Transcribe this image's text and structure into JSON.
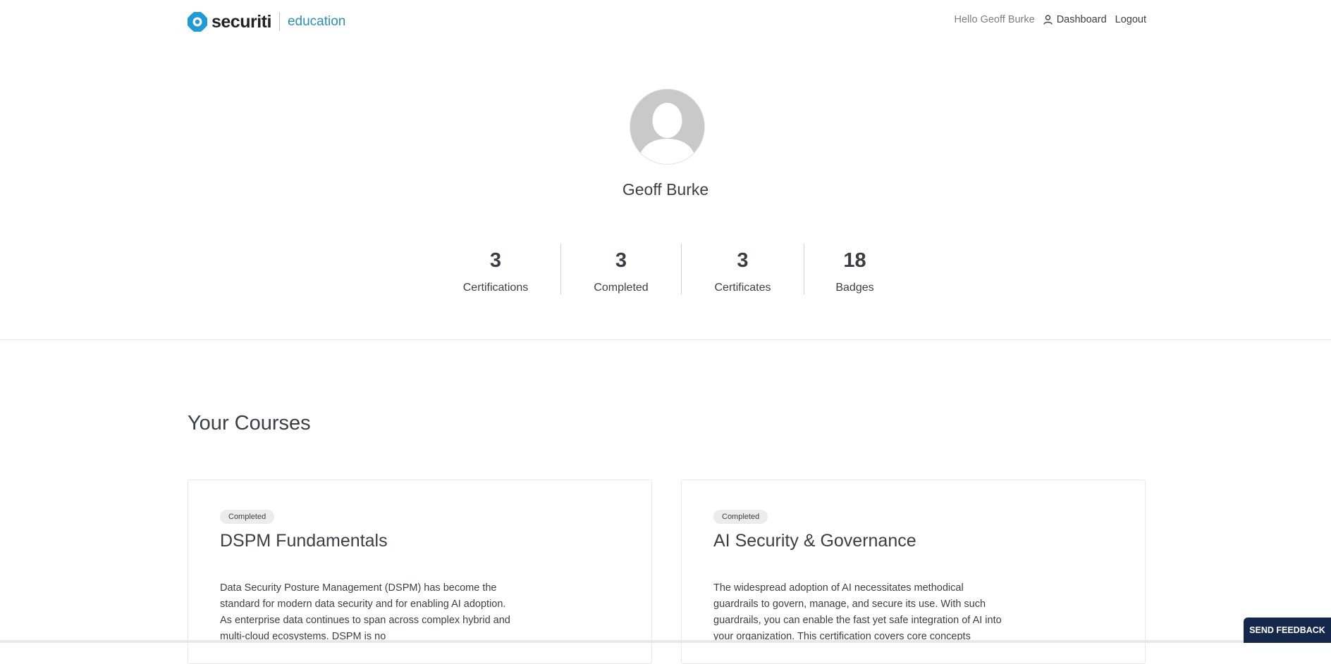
{
  "header": {
    "logo_text": "securiti",
    "logo_sub": "education",
    "greeting": "Hello Geoff Burke",
    "dashboard_label": "Dashboard",
    "logout_label": "Logout"
  },
  "profile": {
    "name": "Geoff Burke"
  },
  "stats": [
    {
      "value": "3",
      "label": "Certifications"
    },
    {
      "value": "3",
      "label": "Completed"
    },
    {
      "value": "3",
      "label": "Certificates"
    },
    {
      "value": "18",
      "label": "Badges"
    }
  ],
  "courses": {
    "title": "Your Courses",
    "items": [
      {
        "status": "Completed",
        "title": "DSPM Fundamentals",
        "description": "Data Security Posture Management (DSPM) has become the standard for modern data security and for enabling AI adoption. As enterprise data continues to span across complex hybrid and multi-cloud ecosystems. DSPM is no"
      },
      {
        "status": "Completed",
        "title": "AI Security & Governance",
        "description": "The widespread adoption of AI necessitates methodical guardrails to govern, manage, and secure its use. With such guardrails, you can enable the fast yet safe integration of AI into your organization. This certification covers core concepts"
      }
    ]
  },
  "feedback_label": "SEND FEEDBACK",
  "colors": {
    "brand_blue": "#2a8fb5",
    "logo_mark": "#1e9bd7",
    "feedback_bg": "#15284b",
    "text": "#3b3f45"
  }
}
